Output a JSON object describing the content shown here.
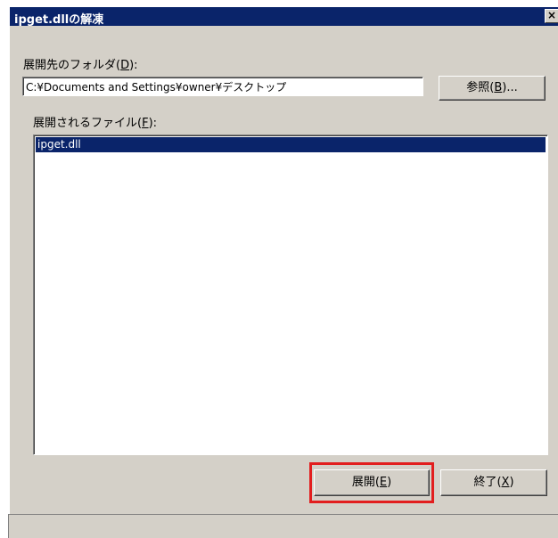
{
  "window": {
    "title": "ipget.dllの解凍",
    "close_glyph": "×"
  },
  "destination": {
    "label_prefix": "展開先のフォルダ(",
    "label_key": "D",
    "label_suffix": "):",
    "path": "C:¥Documents and Settings¥owner¥デスクトップ",
    "browse_prefix": "参照(",
    "browse_key": "B",
    "browse_suffix": ")..."
  },
  "files": {
    "label_prefix": "展開されるファイル(",
    "label_key": "F",
    "label_suffix": "):",
    "items": [
      "ipget.dll"
    ]
  },
  "actions": {
    "extract_prefix": "展開(",
    "extract_key": "E",
    "extract_suffix": ")",
    "exit_prefix": "終了(",
    "exit_key": "X",
    "exit_suffix": ")"
  },
  "colors": {
    "title_bar": "#0a246a",
    "selection": "#0a246a",
    "highlight_box": "#e21e1e",
    "dialog_face": "#d4d0c8"
  }
}
